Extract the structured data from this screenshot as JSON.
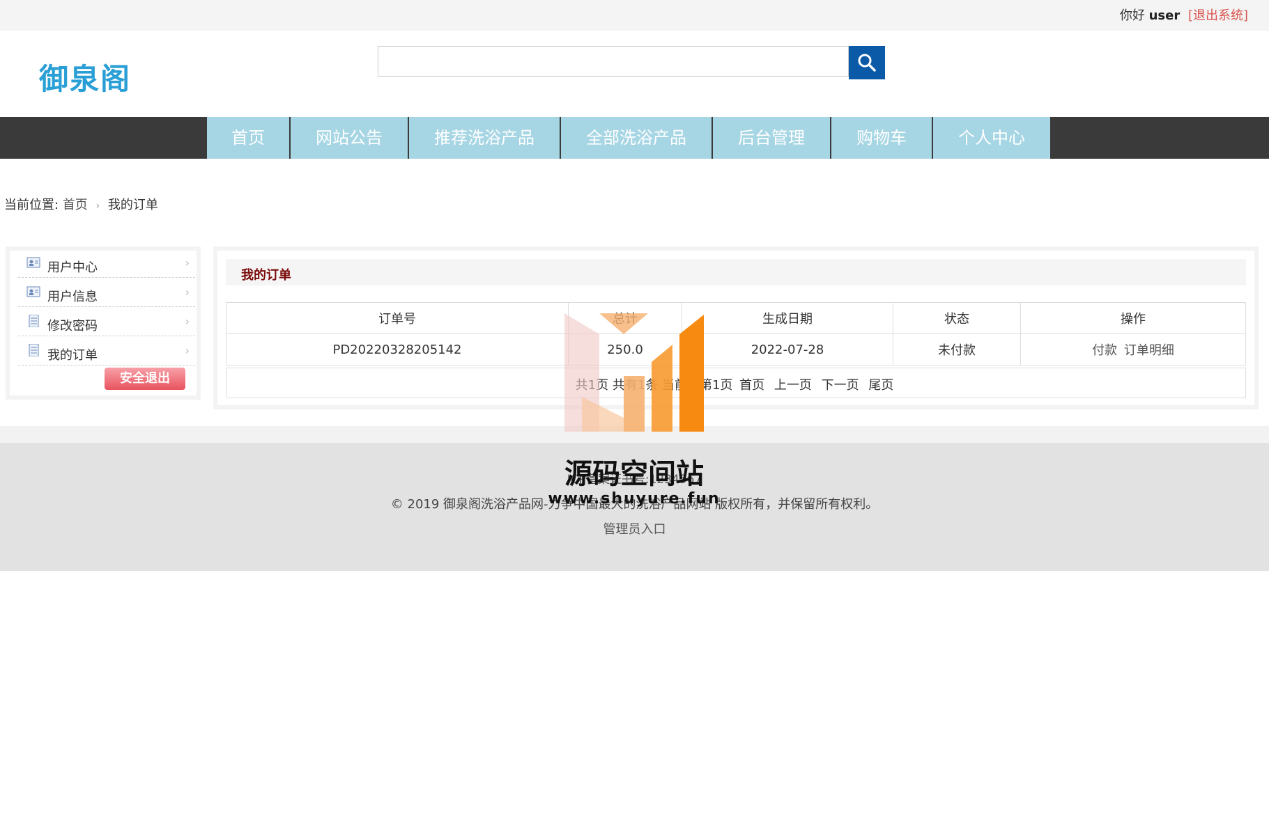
{
  "topbar": {
    "greeting": "你好",
    "username": "user",
    "logout": "[退出系统]"
  },
  "header": {
    "logo": "御泉阁",
    "search_placeholder": ""
  },
  "nav": [
    "首页",
    "网站公告",
    "推荐洗浴产品",
    "全部洗浴产品",
    "后台管理",
    "购物车",
    "个人中心"
  ],
  "breadcrumb": {
    "prefix": "当前位置:",
    "home": "首页",
    "current": "我的订单"
  },
  "sidebar": {
    "items": [
      "用户中心",
      "用户信息",
      "修改密码",
      "我的订单"
    ],
    "exit_button": "安全退出"
  },
  "panel": {
    "title": "我的订单",
    "columns": [
      "订单号",
      "总计",
      "生成日期",
      "状态",
      "操作"
    ],
    "rows": [
      {
        "order_no": "PD20220328205142",
        "total": "250.0",
        "date": "2022-07-28",
        "status": "未付款",
        "pay": "付款",
        "detail": "订单明细"
      }
    ],
    "pager": {
      "summary": "共1页 共有1条 当前为第1页",
      "first": "首页",
      "prev": "上一页",
      "next": "下一页",
      "last": "尾页"
    }
  },
  "footer": {
    "icp": "ICP备案证书号:1234567",
    "copyright": "© 2019 御泉阁洗浴产品网-力争中国最大的洗浴产品网站 版权所有，并保留所有权利。",
    "admin_link": "管理员入口"
  },
  "watermark": {
    "title": "源码空间站",
    "url": "www.shuyure.fun"
  }
}
